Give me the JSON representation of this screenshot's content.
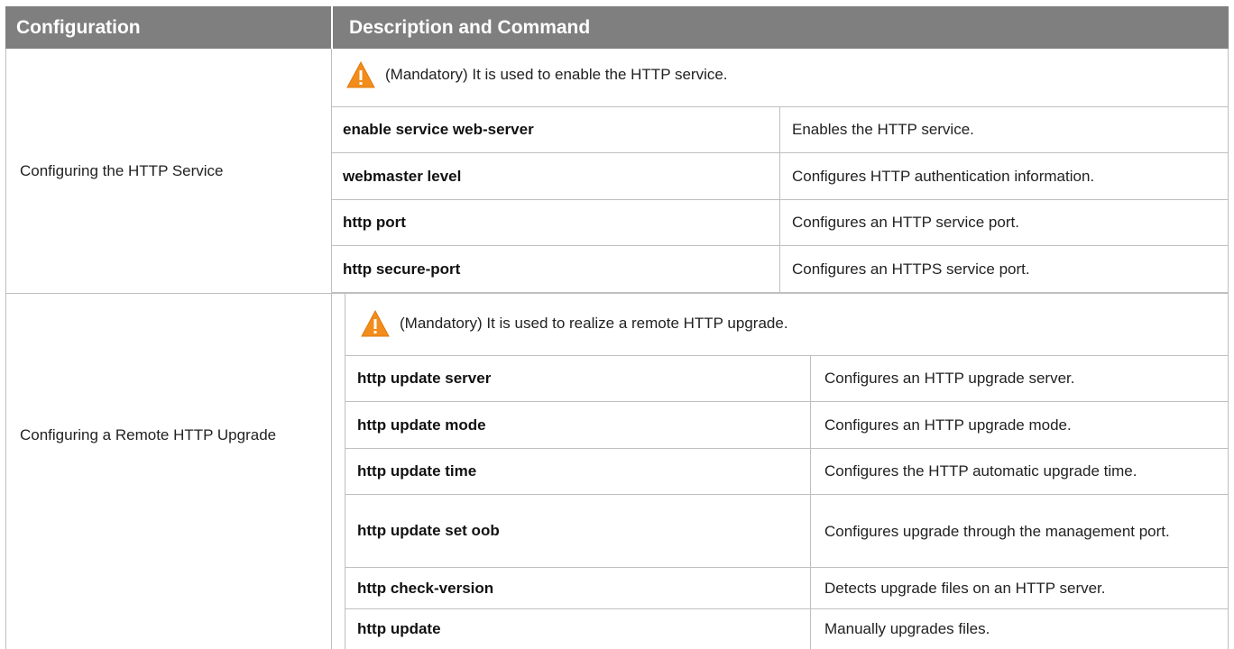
{
  "header": {
    "configuration": "Configuration",
    "description_and_command": "Description and Command"
  },
  "sections": [
    {
      "configuration": "Configuring the HTTP Service",
      "note": "(Mandatory) It is used to enable the HTTP service.",
      "rows": [
        {
          "command": "enable service web-server",
          "description": "Enables the HTTP service."
        },
        {
          "command": "webmaster level",
          "description": "Configures HTTP authentication information."
        },
        {
          "command": "http port",
          "description": "Configures an HTTP service port."
        },
        {
          "command": "http secure-port",
          "description": "Configures an HTTPS service port."
        }
      ]
    },
    {
      "configuration": "Configuring a Remote HTTP Upgrade",
      "note": "(Mandatory) It is used to realize a remote HTTP upgrade.",
      "rows": [
        {
          "command": "http update server",
          "description": "Configures an HTTP upgrade server."
        },
        {
          "command": "http update mode",
          "description": "Configures an HTTP upgrade mode."
        },
        {
          "command": "http update time",
          "description": "Configures the HTTP automatic upgrade time."
        },
        {
          "command": "http update set oob",
          "description": "Configures upgrade through the management port."
        },
        {
          "command": "http check-version",
          "description": "Detects upgrade files on an HTTP server."
        },
        {
          "command": "http update",
          "description": "Manually upgrades files."
        }
      ]
    }
  ],
  "icons": {
    "warning": "warning-icon"
  },
  "colors": {
    "header_bg": "#7f7f7f",
    "header_text": "#ffffff",
    "warning_orange": "#f28c1b",
    "border": "#bfbfbf"
  }
}
